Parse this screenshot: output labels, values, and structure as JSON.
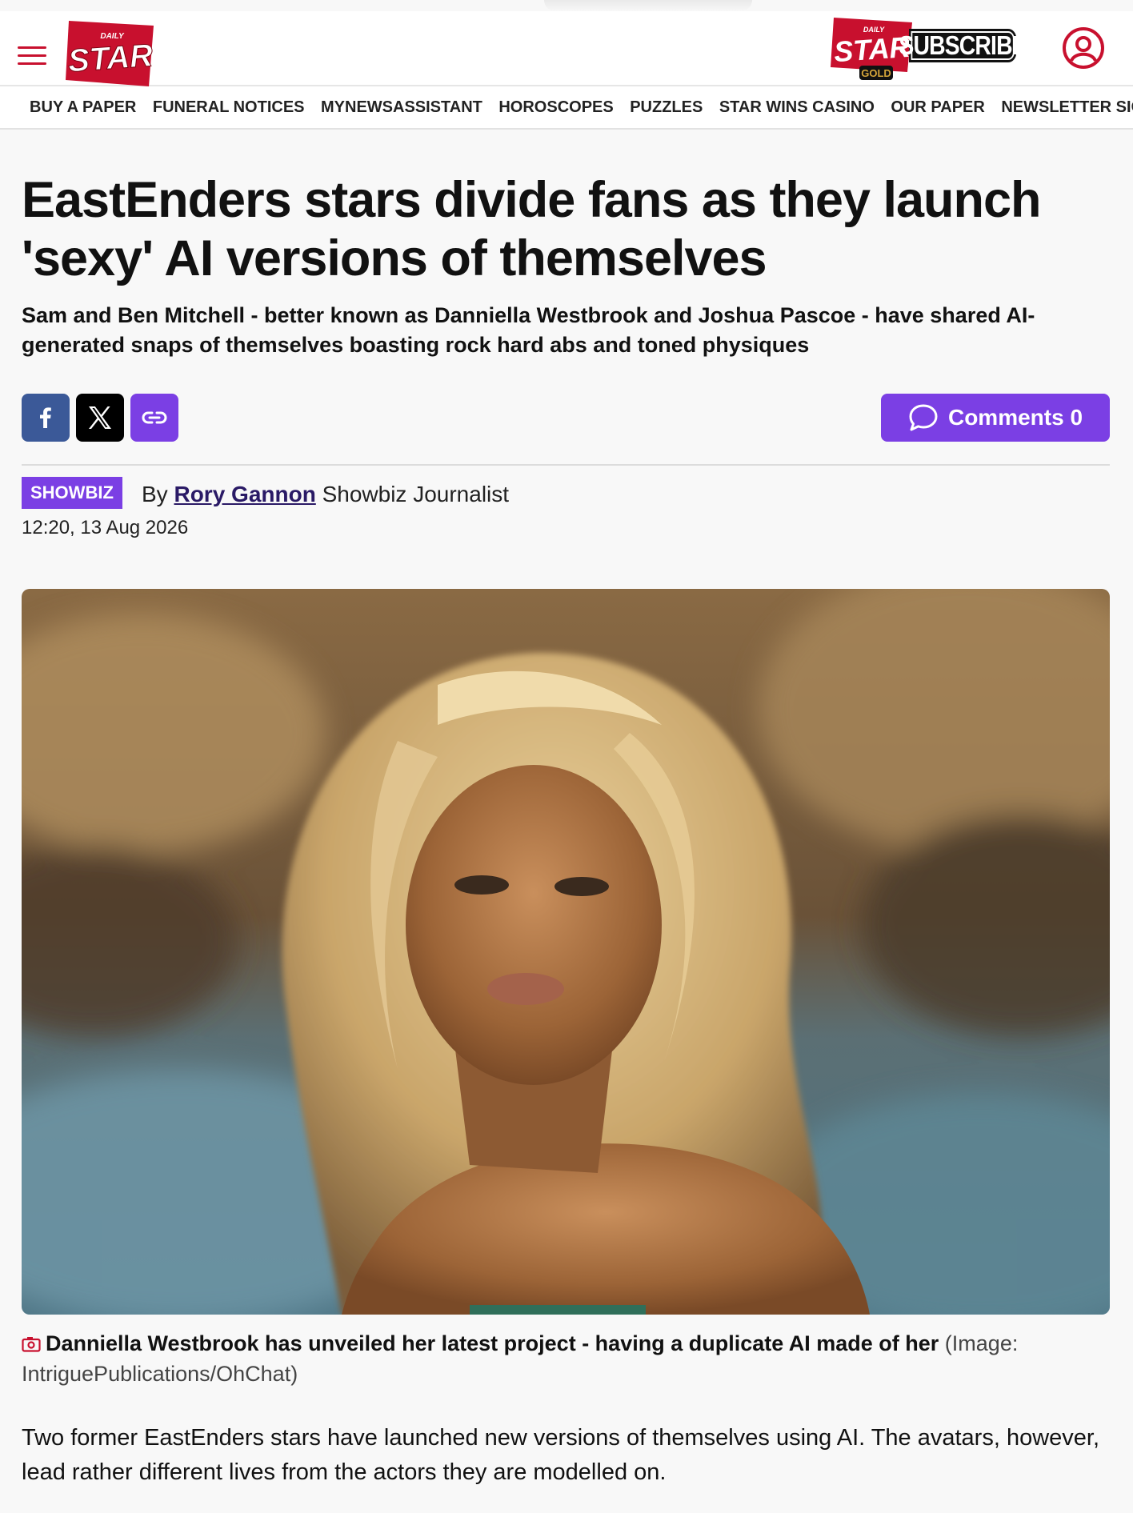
{
  "header": {
    "logo_small": "DAILY",
    "logo_main": "STAR",
    "gold_small": "DAILY",
    "gold_main": "STAR",
    "gold_label": "GOLD",
    "subscribe_label": "SUBSCRIBE",
    "menu_icon": "hamburger-menu-icon",
    "account_icon": "user-account-icon"
  },
  "nav": {
    "items": [
      "BUY A PAPER",
      "FUNERAL NOTICES",
      "MYNEWSASSISTANT",
      "HOROSCOPES",
      "PUZZLES",
      "STAR WINS CASINO",
      "OUR PAPER",
      "NEWSLETTER SIGNUP"
    ]
  },
  "article": {
    "headline": "EastEnders stars divide fans as they launch 'sexy' AI versions of themselves",
    "standfirst": "Sam and Ben Mitchell - better known as Danniella Westbrook and Joshua Pascoe - have shared AI-generated snaps of themselves boasting rock hard abs and toned physiques",
    "comments_label": "Comments 0",
    "category": "SHOWBIZ",
    "by": "By",
    "author": "Rory Gannon",
    "author_role": "Showbiz Journalist",
    "timestamp": "12:20, 13 Aug 2026",
    "caption_main": "Danniella Westbrook has unveiled her latest project - having a duplicate AI made of her",
    "caption_credit": "(Image: IntriguePublications/OhChat)",
    "body": "Two former EastEnders stars have launched new versions of themselves using AI. The avatars, however, lead rather different lives from the actors they are modelled on."
  },
  "colors": {
    "brand_red": "#c8102e",
    "accent_purple": "#7b3fe4",
    "facebook_blue": "#3b5998"
  }
}
